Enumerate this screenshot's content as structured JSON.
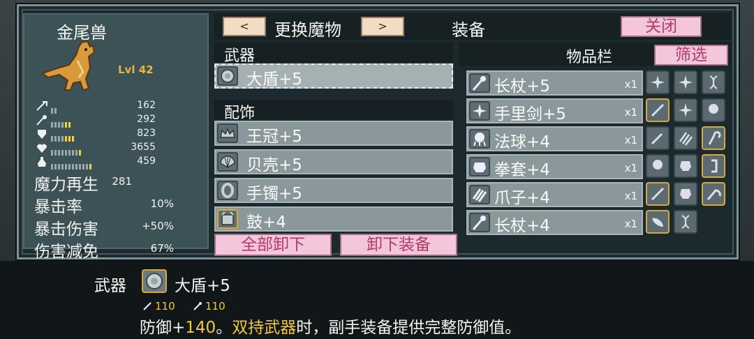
{
  "monster": {
    "name": "金尾兽",
    "level": "Lvl 42",
    "stats": [
      {
        "icon": "sword-icon",
        "value": "162",
        "bars": 2,
        "gold": 0
      },
      {
        "icon": "staff-icon",
        "value": "292",
        "bars": 6,
        "gold": 2
      },
      {
        "icon": "shield-icon",
        "value": "823",
        "bars": 7,
        "gold": 3
      },
      {
        "icon": "heart-icon",
        "value": "3655",
        "bars": 9,
        "gold": 1
      },
      {
        "icon": "potion-icon",
        "value": "459",
        "bars": 12,
        "gold": 1
      }
    ],
    "attributes": [
      {
        "label": "魔力再生",
        "value": "281"
      },
      {
        "label": "暴击率",
        "value": "10%"
      },
      {
        "label": "暴击伤害",
        "value": "+50%"
      },
      {
        "label": "伤害减免",
        "value": "67%"
      }
    ]
  },
  "header": {
    "prev_label": "<",
    "change_label": "更换魔物",
    "next_label": ">",
    "equip_label": "装备",
    "close_label": "关闭"
  },
  "weapon_section": {
    "title": "武器",
    "item": {
      "name": "大盾+5",
      "icon": "shield-round-icon"
    }
  },
  "accessory_section": {
    "title": "配饰",
    "items": [
      {
        "name": "王冠+5",
        "icon": "crown-icon"
      },
      {
        "name": "贝壳+5",
        "icon": "shell-icon"
      },
      {
        "name": "手镯+5",
        "icon": "bracelet-icon"
      },
      {
        "name": "鼓+4",
        "icon": "drum-icon"
      }
    ]
  },
  "actions": {
    "unequip_all": "全部卸下",
    "unequip": "卸下装备"
  },
  "inventory": {
    "title": "物品栏",
    "filter_label": "筛选",
    "items": [
      {
        "name": "长杖+5",
        "qty": "x1",
        "icon": "staff-icon"
      },
      {
        "name": "手里剑+5",
        "qty": "x1",
        "icon": "shuriken-icon"
      },
      {
        "name": "法球+4",
        "qty": "x1",
        "icon": "orb-icon"
      },
      {
        "name": "拳套+4",
        "qty": "x1",
        "icon": "gauntlet-icon"
      },
      {
        "name": "爪子+4",
        "qty": "x1",
        "icon": "claw-icon"
      },
      {
        "name": "长杖+4",
        "qty": "x1",
        "icon": "staff-icon"
      }
    ]
  },
  "tooltip": {
    "category": "武器",
    "item_name": "大盾+5",
    "stat1": "110",
    "stat2": "110",
    "desc_prefix": "防御+",
    "desc_value": "140",
    "desc_mid": "。",
    "desc_highlight": "双持武器",
    "desc_rest": "时，副手装备提供完整防御值。"
  },
  "colors": {
    "accent_gold": "#f0c83a",
    "button_pink": "#f3c6dc",
    "panel_dark": "#1c2a2d"
  }
}
